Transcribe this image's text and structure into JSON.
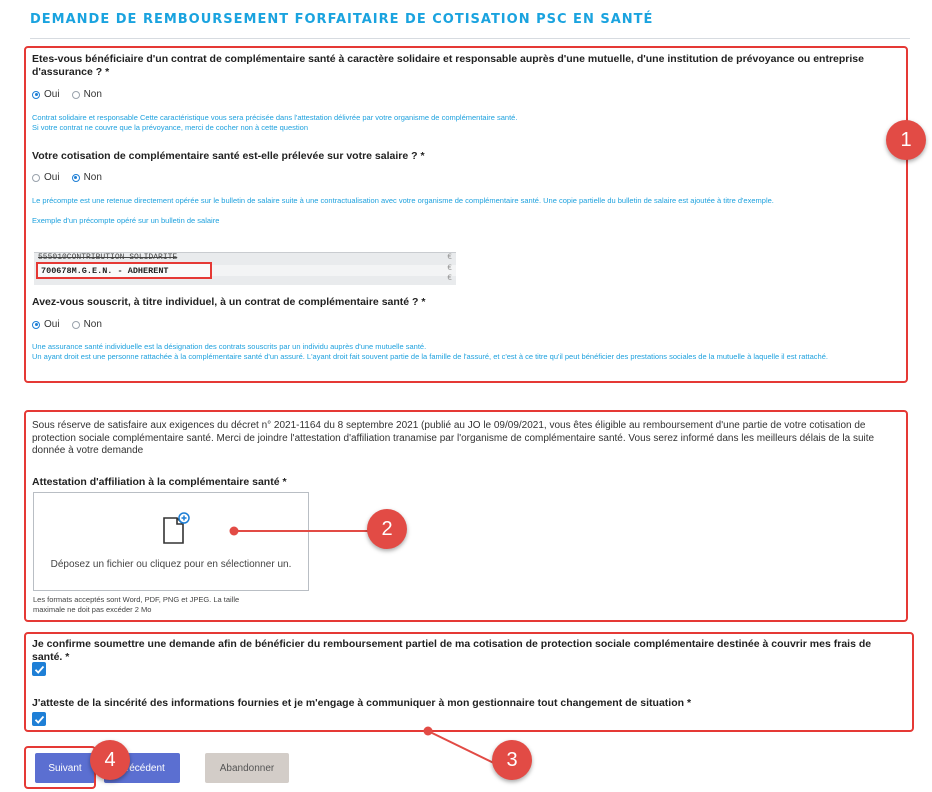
{
  "page_title": "DEMANDE DE REMBOURSEMENT FORFAITAIRE DE COTISATION PSC EN SANTÉ",
  "section1": {
    "q1": {
      "label": "Etes-vous bénéficiaire d'un contrat de complémentaire santé à caractère solidaire et responsable auprès d'une mutuelle, d'une institution de prévoyance ou entreprise d'assurance ? *",
      "options": [
        {
          "label": "Oui",
          "selected": true
        },
        {
          "label": "Non",
          "selected": false
        }
      ],
      "help_1": "Contrat solidaire et responsable Cette caractéristique vous sera précisée dans l'attestation délivrée par votre organisme de complémentaire santé.",
      "help_2": "Si votre contrat ne couvre que la prévoyance, merci de cocher non à cette question"
    },
    "q2": {
      "label": "Votre cotisation de complémentaire santé est-elle prélevée sur votre salaire ? *",
      "options": [
        {
          "label": "Oui",
          "selected": false
        },
        {
          "label": "Non",
          "selected": true
        }
      ],
      "help_1": "Le précompte est une retenue directement opérée sur le bulletin de salaire suite à une contractualisation avec votre organisme de complémentaire santé. Une copie partielle du bulletin de salaire est ajoutée à titre d'exemple.",
      "help_2": "Exemple d'un précompte opéré sur un bulletin de salaire"
    },
    "payslip": {
      "line1": "555010CONTRIBUTION SOLIDARITE",
      "line2": "700678M.G.E.N. - ADHERENT",
      "tick": "€"
    },
    "q3": {
      "label": "Avez-vous souscrit, à titre individuel, à un contrat de complémentaire santé ? *",
      "options": [
        {
          "label": "Oui",
          "selected": true
        },
        {
          "label": "Non",
          "selected": false
        }
      ],
      "help_1": "Une assurance santé individuelle est la désignation des contrats souscrits par un individu auprès d'une mutuelle santé.",
      "help_2": "Un ayant droit est une personne rattachée à la complémentaire santé d'un assuré. L'ayant droit fait souvent partie de la famille de l'assuré, et c'est à ce titre qu'il peut bénéficier des prestations sociales de la mutuelle à laquelle il est rattaché."
    }
  },
  "section2": {
    "paragraph": "Sous réserve de satisfaire aux exigences du décret n° 2021-1164 du 8 septembre 2021 (publié au JO le 09/09/2021, vous êtes éligible au remboursement d'une partie de votre cotisation de protection sociale complémentaire santé. Merci de joindre l'attestation d'affiliation tranamise par l'organisme de complémentaire santé. Vous serez informé dans les meilleurs délais de la suite donnée à votre demande",
    "upload_label": "Attestation d'affiliation à la complémentaire santé *",
    "dropzone_text": "Déposez un fichier ou cliquez pour en sélectionner un.",
    "formats_line1": "Les formats acceptés sont Word, PDF, PNG et JPEG. La taille",
    "formats_line2": "maximale ne doit pas excéder 2 Mo"
  },
  "section3": {
    "confirm_label": "Je confirme soumettre une demande afin de bénéficier du remboursement partiel de ma cotisation de protection sociale complémentaire destinée à couvrir mes frais de santé. *",
    "confirm_checked": true,
    "attest_label": "J'atteste de la sincérité des informations fournies et je m'engage à communiquer à mon gestionnaire tout changement de situation *",
    "attest_checked": true
  },
  "buttons": {
    "next": "Suivant",
    "previous": "Précédent",
    "abandon": "Abandonner"
  },
  "badges": [
    "1",
    "2",
    "3",
    "4"
  ],
  "colors": {
    "title": "#1aa3df",
    "help_text": "#1ea1de",
    "annotation_red": "#e53935",
    "badge_red": "#e24b45",
    "primary_button": "#5b6fd1",
    "checkbox": "#1e7fd6",
    "secondary_button": "#d3cdc8"
  }
}
